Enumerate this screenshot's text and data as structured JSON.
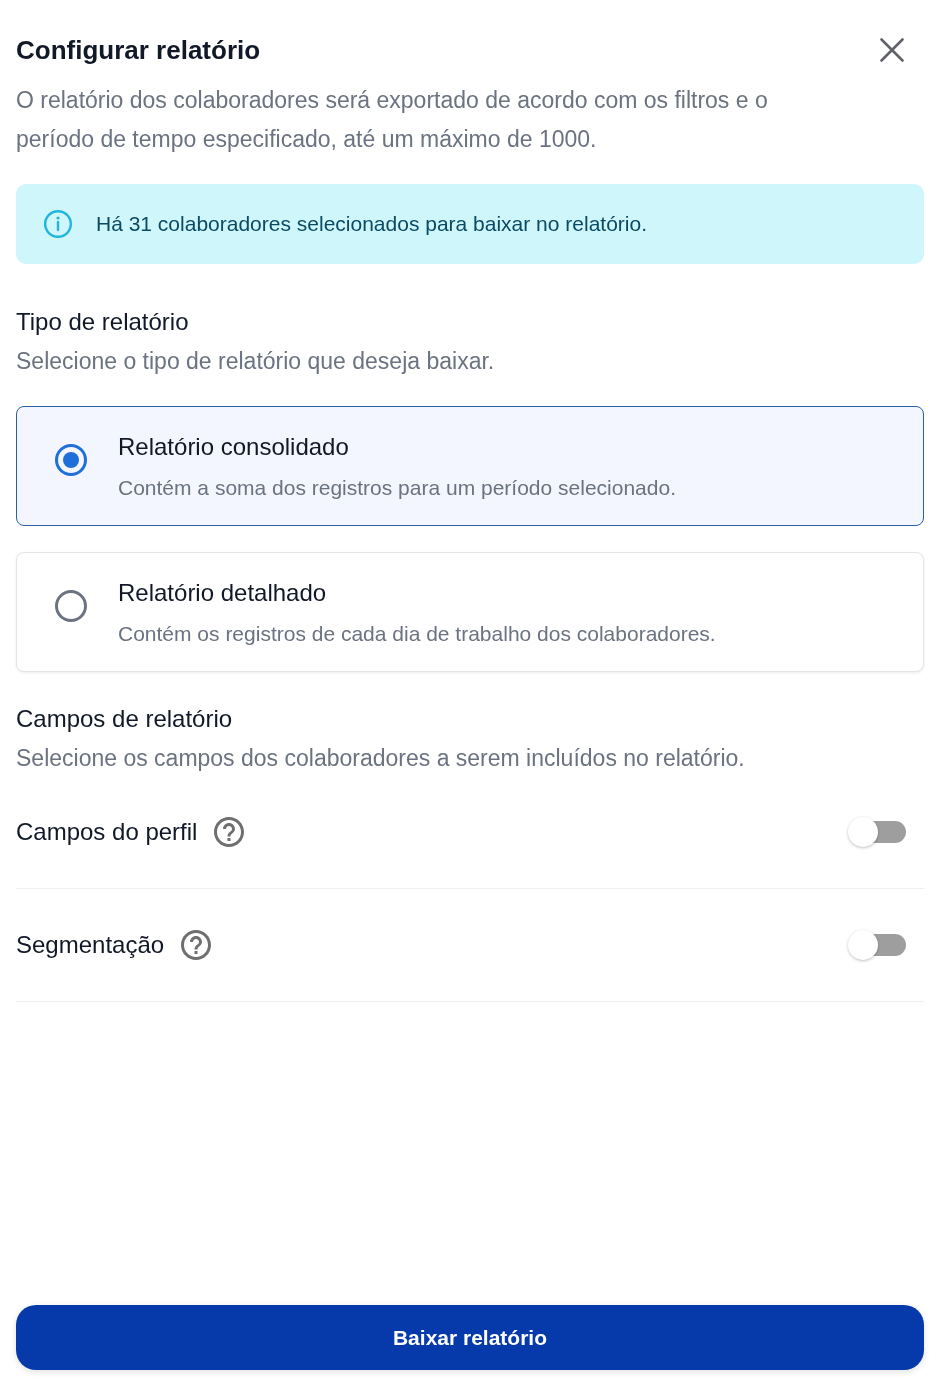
{
  "dialog": {
    "title": "Configurar relatório",
    "description": "O relatório dos colaboradores será exportado de acordo com os filtros e o período de tempo especificado, até um máximo de 1000."
  },
  "info_banner": {
    "text": "Há 31 colaboradores selecionados para baixar no relatório."
  },
  "report_type": {
    "title": "Tipo de relatório",
    "subtitle": "Selecione o tipo de relatório que deseja baixar.",
    "options": [
      {
        "title": "Relatório consolidado",
        "description": "Contém a soma dos registros para um período selecionado.",
        "selected": true
      },
      {
        "title": "Relatório detalhado",
        "description": "Contém os registros de cada dia de trabalho dos colaboradores.",
        "selected": false
      }
    ]
  },
  "report_fields": {
    "title": "Campos de relatório",
    "subtitle": "Selecione os campos dos colaboradores a serem incluídos no relatório.",
    "toggles": [
      {
        "label": "Campos do perfil",
        "on": false
      },
      {
        "label": "Segmentação",
        "on": false
      }
    ]
  },
  "primary_button": {
    "label": "Baixar relatório"
  }
}
